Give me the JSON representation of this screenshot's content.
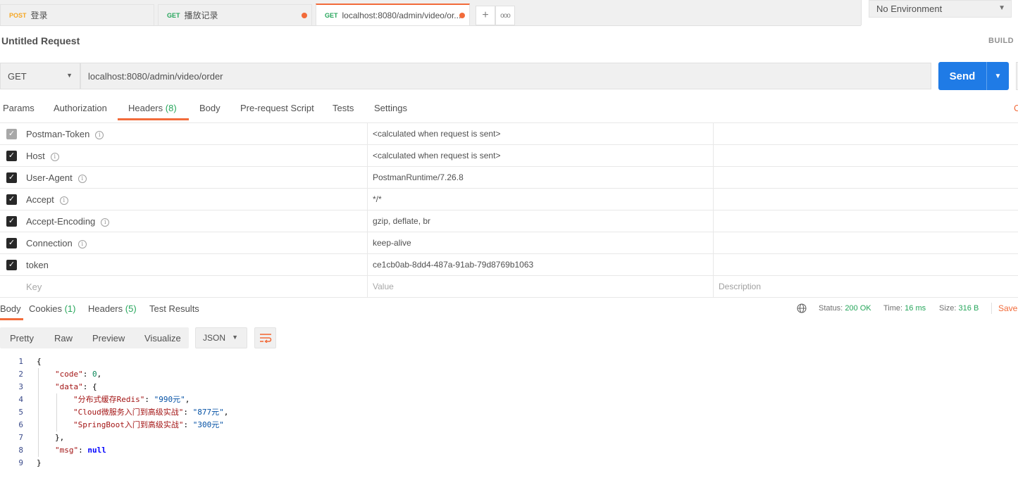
{
  "tabs": [
    {
      "method": "POST",
      "method_color": "#f5a623",
      "title": "登录"
    },
    {
      "method": "GET",
      "method_color": "#26a65b",
      "title": "播放记录"
    },
    {
      "method": "GET",
      "method_color": "#26a65b",
      "title": "localhost:8080/admin/video/or..."
    }
  ],
  "environment": {
    "selected": "No Environment"
  },
  "request": {
    "title": "Untitled Request",
    "build_label": "BUILD",
    "method": "GET",
    "url": "localhost:8080/admin/video/order",
    "send_label": "Send"
  },
  "request_tabs": {
    "params": "Params",
    "authorization": "Authorization",
    "headers": "Headers",
    "headers_count": "(8)",
    "body": "Body",
    "prerequest": "Pre-request Script",
    "tests": "Tests",
    "settings": "Settings",
    "cookies_edge": "C"
  },
  "headers": [
    {
      "key": "Postman-Token",
      "value": "<calculated when request is sent>",
      "info": true,
      "disabled": true
    },
    {
      "key": "Host",
      "value": "<calculated when request is sent>",
      "info": true,
      "disabled": false
    },
    {
      "key": "User-Agent",
      "value": "PostmanRuntime/7.26.8",
      "info": true,
      "disabled": false
    },
    {
      "key": "Accept",
      "value": "*/*",
      "info": true,
      "disabled": false
    },
    {
      "key": "Accept-Encoding",
      "value": "gzip, deflate, br",
      "info": true,
      "disabled": false
    },
    {
      "key": "Connection",
      "value": "keep-alive",
      "info": true,
      "disabled": false
    },
    {
      "key": "token",
      "value": "ce1cb0ab-8dd4-487a-91ab-79d8769b1063",
      "info": false,
      "disabled": false
    }
  ],
  "headers_placeholder": {
    "key": "Key",
    "value": "Value",
    "description": "Description"
  },
  "response_tabs": {
    "body": "Body",
    "cookies": "Cookies",
    "cookies_count": "(1)",
    "headers": "Headers",
    "headers_count": "(5)",
    "test_results": "Test Results"
  },
  "response_status": {
    "status_label": "Status:",
    "status": "200 OK",
    "time_label": "Time:",
    "time": "16 ms",
    "size_label": "Size:",
    "size": "316 B",
    "save_label": "Save"
  },
  "viewer": {
    "pretty": "Pretty",
    "raw": "Raw",
    "preview": "Preview",
    "visualize": "Visualize",
    "format": "JSON"
  },
  "code": {
    "line_numbers": [
      "1",
      "2",
      "3",
      "4",
      "5",
      "6",
      "7",
      "8",
      "9"
    ],
    "open_brace": "{",
    "code_key": "\"code\"",
    "code_value": "0",
    "data_key": "\"data\"",
    "item1_key": "\"分布式缓存Redis\"",
    "item1_value": "\"990元\"",
    "item2_key": "\"Cloud微服务入门到高级实战\"",
    "item2_value": "\"877元\"",
    "item3_key": "\"SpringBoot入门到高级实战\"",
    "item3_value": "\"300元\"",
    "msg_key": "\"msg\"",
    "msg_value": "null",
    "close_brace": "}"
  },
  "colors": {
    "accent": "#f26b3a",
    "send": "#1f7be6",
    "success": "#26a65b"
  }
}
